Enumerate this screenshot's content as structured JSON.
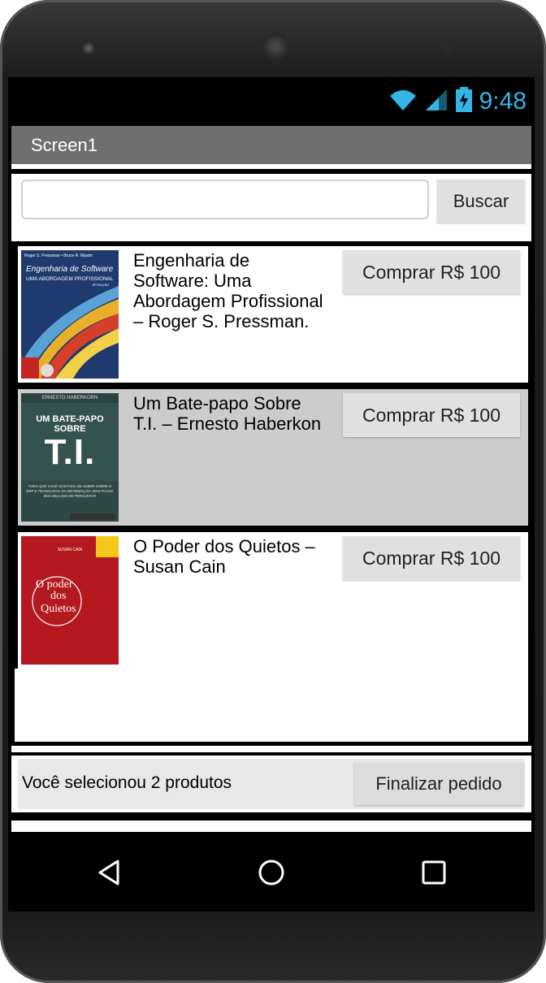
{
  "status": {
    "time": "9:48",
    "wifi_icon": "wifi-icon",
    "signal_icon": "signal-icon",
    "battery_icon": "battery-charging-icon",
    "accent": "#33b5e5"
  },
  "screen_title": "Screen1",
  "search": {
    "value": "",
    "placeholder": "",
    "button_label": "Buscar"
  },
  "products": [
    {
      "title": "Engenharia de Software: Uma Abordagem Profissional – Roger S. Pressman.",
      "buy_label": "Comprar R$ 100",
      "cover": {
        "authors": "Roger S. Pressman • Bruce R. Maxim",
        "title": "Engenharia de Software",
        "subtitle": "UMA ABORDAGEM PROFISSIONAL",
        "edition": "8ª EDIÇÃO"
      },
      "selected": false
    },
    {
      "title": "Um Bate-papo Sobre T.I. – Ernesto Haberkon",
      "buy_label": "Comprar R$ 100",
      "cover": {
        "author": "ERNESTO HABERKORN",
        "title_1": "UM BATE-PAPO",
        "title_2": "SOBRE",
        "title_3": "T.I.",
        "tagline": "TUDO QUE VOCÊ GOSTARIA DE SABER SOBRE O ERP E TECNOLOGIA DA INFORMAÇÃO, MAS FICAVA ENCABULADO DE PERGUNTAR"
      },
      "selected": true
    },
    {
      "title": "O Poder dos Quietos – Susan Cain",
      "buy_label": "Comprar R$ 100",
      "cover": {
        "author": "SUSAN CAIN",
        "title_1": "O poder",
        "title_2": "dos",
        "title_3": "Quietos"
      },
      "selected": false
    }
  ],
  "footer": {
    "message": "Você selecionou 2 produtos",
    "finish_label": "Finalizar pedido"
  },
  "nav": {
    "back_icon": "back-triangle-icon",
    "home_icon": "home-circle-icon",
    "recents_icon": "recents-square-icon"
  },
  "colors": {
    "title_bar": "#6f6f6f",
    "selected_row": "#cccccc",
    "button": "#e0e0e0"
  }
}
